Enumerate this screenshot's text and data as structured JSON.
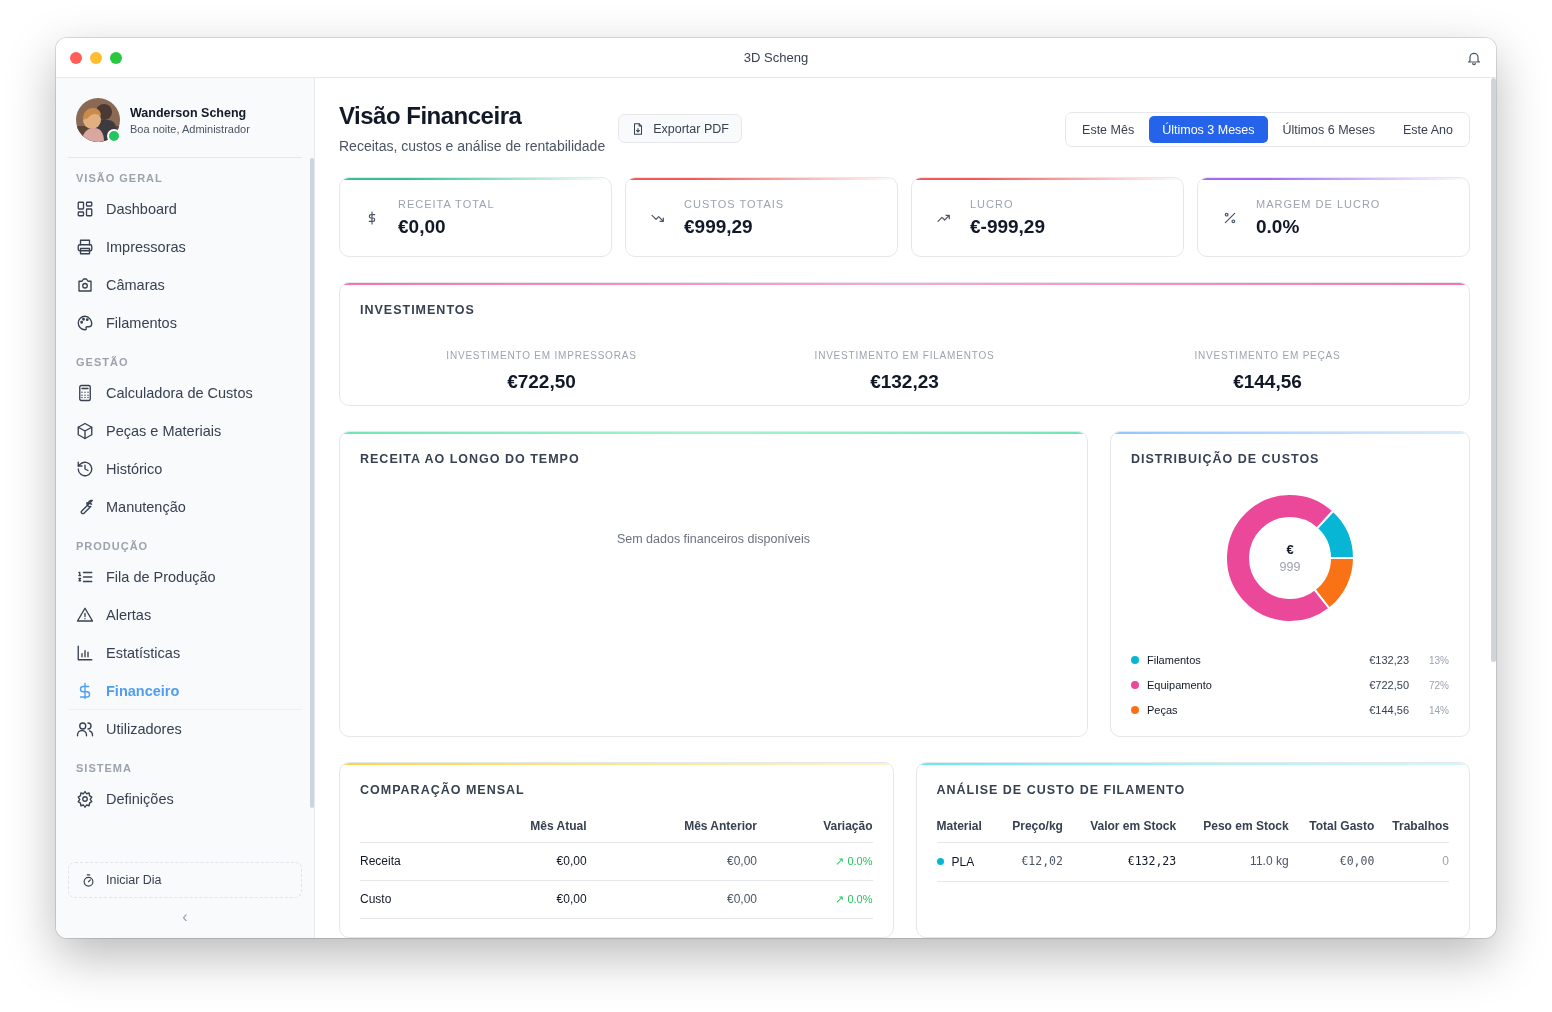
{
  "window": {
    "title": "3D Scheng"
  },
  "user": {
    "name": "Wanderson Scheng",
    "greeting": "Boa noite, Administrador",
    "online": true
  },
  "sidebar": {
    "sections": [
      {
        "title": "VISÃO GERAL",
        "items": [
          {
            "label": "Dashboard",
            "selected": false
          },
          {
            "label": "Impressoras",
            "selected": false
          },
          {
            "label": "Câmaras",
            "selected": false
          },
          {
            "label": "Filamentos",
            "selected": false
          }
        ]
      },
      {
        "title": "GESTÃO",
        "items": [
          {
            "label": "Calculadora de Custos",
            "selected": false
          },
          {
            "label": "Peças e Materiais",
            "selected": false
          },
          {
            "label": "Histórico",
            "selected": false
          },
          {
            "label": "Manutenção",
            "selected": false
          }
        ]
      },
      {
        "title": "PRODUÇÃO",
        "items": [
          {
            "label": "Fila de Produção",
            "selected": false
          },
          {
            "label": "Alertas",
            "selected": false
          },
          {
            "label": "Estatísticas",
            "selected": false
          },
          {
            "label": "Financeiro",
            "selected": true
          },
          {
            "label": "Utilizadores",
            "selected": false
          }
        ]
      },
      {
        "title": "SISTEMA",
        "items": [
          {
            "label": "Definições",
            "selected": false
          }
        ]
      }
    ],
    "start_button": "Iniciar Dia",
    "collapse": "‹"
  },
  "header": {
    "title": "Visão Financeira",
    "subtitle": "Receitas, custos e análise de rentabilidade",
    "export_button": "Exportar PDF"
  },
  "periods": [
    {
      "label": "Este Mês",
      "selected": false
    },
    {
      "label": "Últimos 3 Meses",
      "selected": true
    },
    {
      "label": "Últimos 6 Meses",
      "selected": false
    },
    {
      "label": "Este Ano",
      "selected": false
    }
  ],
  "kpis": [
    {
      "label": "RECEITA TOTAL",
      "value": "€0,00",
      "color": "#34c38f"
    },
    {
      "label": "CUSTOS TOTAIS",
      "value": "€999,29",
      "color": "#ef5b5b"
    },
    {
      "label": "LUCRO",
      "value": "€-999,29",
      "color": "#ef5b5b"
    },
    {
      "label": "MARGEM DE LUCRO",
      "value": "0.0%",
      "color": "#a26cf0"
    }
  ],
  "investments": {
    "title": "INVESTIMENTOS",
    "items": [
      {
        "label": "INVESTIMENTO EM IMPRESSORAS",
        "value": "€722,50"
      },
      {
        "label": "INVESTIMENTO EM FILAMENTOS",
        "value": "€132,23"
      },
      {
        "label": "INVESTIMENTO EM PEÇAS",
        "value": "€144,56"
      }
    ]
  },
  "revenue": {
    "title": "RECEITA AO LONGO DO TEMPO",
    "empty_message": "Sem dados financeiros disponíveis"
  },
  "cost_distribution": {
    "title": "DISTRIBUIÇÃO DE CUSTOS",
    "center_symbol": "€",
    "center_value": "999",
    "chart_data": {
      "type": "donut",
      "categories": [
        "Filamentos",
        "Equipamento",
        "Peças"
      ],
      "values": [
        13.23,
        72.3,
        14.47
      ]
    },
    "legend": [
      {
        "color": "#06b6d4",
        "value": "€132,23",
        "percent": "13%"
      },
      {
        "color": "#ec4899",
        "value": "€722,50",
        "percent": "72%"
      },
      {
        "color": "#f97316",
        "value": "€144,56",
        "percent": "14%"
      }
    ]
  },
  "monthly": {
    "title": "COMPARAÇÃO MENSAL",
    "columns": [
      "Mês Atual",
      "Mês Anterior",
      "Variação"
    ],
    "rows": [
      {
        "label": "Receita",
        "current": "€0,00",
        "previous": "€0,00",
        "change": "↗ 0.0%"
      },
      {
        "label": "Custo",
        "current": "€0,00",
        "previous": "€0,00",
        "change": "↗ 0.0%"
      }
    ]
  },
  "filament": {
    "title": "ANÁLISE DE CUSTO DE FILAMENTO",
    "columns": [
      "Material",
      "Preço/kg",
      "Valor em Stock",
      "Peso em Stock",
      "Total Gasto",
      "Trabalhos"
    ],
    "rows": [
      {
        "material": "PLA",
        "color": "#06b6d4",
        "price": "€12,02",
        "stock_value": "€132,23",
        "stock_weight": "11.0 kg",
        "total_spent": "€0,00",
        "jobs": "0"
      }
    ]
  }
}
